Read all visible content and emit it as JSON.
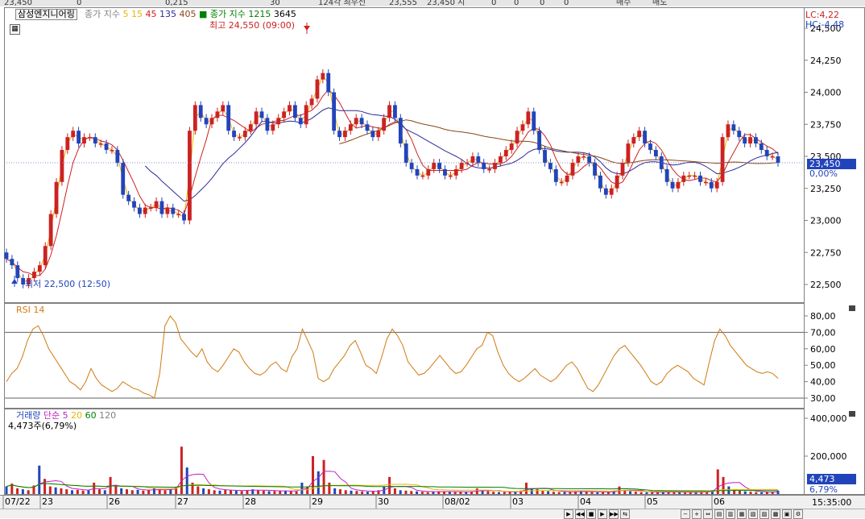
{
  "top_bar": {
    "values": [
      "23,450",
      "0",
      "0,215",
      "30",
      "124각 최우선",
      "23,555",
      "23,450 시",
      "0",
      "0",
      "0",
      "0",
      "매수",
      "매도"
    ]
  },
  "symbol": "삼성엔지니어링",
  "legend": {
    "price_ma_label": "종가 지수",
    "price_ma": [
      {
        "period": "5",
        "color": "#e6b800"
      },
      {
        "period": "15",
        "color": "#e6b800"
      },
      {
        "period": "45",
        "color": "#cc2222"
      },
      {
        "period": "135",
        "color": "#2b2b9c"
      },
      {
        "period": "405",
        "color": "#8b4513"
      }
    ],
    "extra_label": "종가 지수",
    "extra": [
      {
        "period": "1215",
        "color": "#008000"
      },
      {
        "period": "3645",
        "color": "#000000"
      }
    ]
  },
  "annotations": {
    "high": "최고 24,550 (09:00)",
    "low": "최저 22,500 (12:50)",
    "lc": "LC:4,22",
    "hc": "HC:-4,48",
    "current_price": "23,450",
    "change_pct": "0,00%",
    "volume_now": "4,473주(6,79%)",
    "volume_box": "4,473",
    "volume_pct": "6,79%",
    "time": "15:35:00"
  },
  "rsi_title": "RSI 14",
  "volume_title": "거래량",
  "volume_ma": [
    {
      "label": "단순 5",
      "color": "#c020c0"
    },
    {
      "label": "20",
      "color": "#e6b800"
    },
    {
      "label": "60",
      "color": "#008000"
    },
    {
      "label": "120",
      "color": "#808080"
    }
  ],
  "colors": {
    "up": "#cc2222",
    "down": "#2244bb",
    "rsi": "#d07a10",
    "axis": "#606060"
  },
  "chart_data": [
    {
      "type": "candlestick",
      "title": "삼성엔지니어링",
      "ylim": [
        22450,
        24550
      ],
      "yticks": [
        "22,500",
        "22,750",
        "23,000",
        "23,250",
        "23,500",
        "23,750",
        "24,000",
        "24,250",
        "24,500"
      ],
      "ytick_values": [
        22500,
        22750,
        23000,
        23250,
        23500,
        23750,
        24000,
        24250,
        24500
      ],
      "x_tick_labels": [
        "07/22",
        "23",
        "26",
        "27",
        "28",
        "29",
        "30",
        "08/02",
        "03",
        "04",
        "05",
        "06"
      ],
      "close_path": [
        22700,
        22650,
        22550,
        22500,
        22550,
        22600,
        22650,
        22800,
        23050,
        23300,
        23550,
        23650,
        23700,
        23600,
        23650,
        23650,
        23600,
        23600,
        23550,
        23550,
        23450,
        23200,
        23150,
        23100,
        23050,
        23100,
        23100,
        23150,
        23050,
        23100,
        23050,
        23050,
        23000,
        23700,
        23900,
        23800,
        23750,
        23800,
        23850,
        23900,
        23700,
        23650,
        23650,
        23700,
        23750,
        23850,
        23800,
        23700,
        23750,
        23800,
        23850,
        23900,
        23800,
        23750,
        23900,
        23950,
        24100,
        24150,
        24000,
        23700,
        23650,
        23700,
        23750,
        23800,
        23750,
        23700,
        23650,
        23700,
        23800,
        23900,
        23800,
        23600,
        23450,
        23400,
        23350,
        23350,
        23400,
        23450,
        23400,
        23350,
        23350,
        23400,
        23450,
        23450,
        23500,
        23450,
        23400,
        23400,
        23450,
        23500,
        23550,
        23600,
        23700,
        23750,
        23850,
        23700,
        23550,
        23450,
        23400,
        23300,
        23300,
        23350,
        23450,
        23500,
        23500,
        23450,
        23350,
        23250,
        23200,
        23250,
        23350,
        23450,
        23600,
        23650,
        23700,
        23600,
        23550,
        23500,
        23400,
        23300,
        23250,
        23300,
        23350,
        23350,
        23350,
        23300,
        23300,
        23250,
        23300,
        23650,
        23750,
        23700,
        23650,
        23600,
        23650,
        23600,
        23550,
        23500,
        23500,
        23450
      ],
      "ma_lines": [
        "5",
        "15",
        "45",
        "135",
        "405"
      ]
    },
    {
      "type": "line",
      "title": "RSI 14",
      "ylim": [
        25,
        85
      ],
      "yticks": [
        "30,00",
        "40,00",
        "50,00",
        "60,00",
        "70,00",
        "80,00"
      ],
      "ytick_values": [
        30,
        40,
        50,
        60,
        70,
        80
      ],
      "reference_lines": [
        70,
        30
      ],
      "values": [
        40,
        45,
        48,
        55,
        65,
        72,
        74,
        68,
        60,
        55,
        50,
        45,
        40,
        38,
        35,
        40,
        48,
        42,
        38,
        36,
        34,
        36,
        40,
        38,
        36,
        35,
        33,
        32,
        30,
        45,
        74,
        80,
        76,
        66,
        62,
        58,
        55,
        60,
        52,
        48,
        46,
        50,
        55,
        60,
        58,
        52,
        48,
        45,
        44,
        46,
        50,
        52,
        48,
        46,
        55,
        60,
        72,
        65,
        58,
        42,
        40,
        42,
        48,
        52,
        56,
        62,
        65,
        58,
        50,
        48,
        45,
        55,
        66,
        72,
        68,
        62,
        52,
        48,
        44,
        45,
        48,
        52,
        56,
        52,
        48,
        45,
        46,
        50,
        55,
        60,
        62,
        70,
        68,
        58,
        50,
        45,
        42,
        40,
        42,
        45,
        48,
        44,
        42,
        40,
        42,
        46,
        50,
        52,
        48,
        42,
        36,
        34,
        38,
        44,
        50,
        56,
        60,
        62,
        58,
        54,
        50,
        45,
        40,
        38,
        40,
        45,
        48,
        50,
        48,
        46,
        42,
        40,
        38,
        52,
        65,
        72,
        68,
        62,
        58,
        54,
        50,
        48,
        46,
        45,
        46,
        45,
        42
      ]
    },
    {
      "type": "bar",
      "title": "거래량",
      "ylim": [
        0,
        420000
      ],
      "yticks": [
        "200,000",
        "400,000"
      ],
      "ytick_values": [
        200000,
        400000
      ],
      "values": [
        40000,
        55000,
        30000,
        25000,
        20000,
        45000,
        150000,
        80000,
        40000,
        35000,
        30000,
        25000,
        20000,
        22000,
        18000,
        20000,
        60000,
        25000,
        20000,
        90000,
        40000,
        30000,
        25000,
        20000,
        22000,
        18000,
        20000,
        30000,
        25000,
        20000,
        25000,
        35000,
        250000,
        140000,
        60000,
        40000,
        30000,
        25000,
        20000,
        18000,
        22000,
        20000,
        18000,
        16000,
        20000,
        25000,
        20000,
        18000,
        15000,
        16000,
        15000,
        18000,
        16000,
        14000,
        60000,
        40000,
        200000,
        120000,
        180000,
        60000,
        30000,
        25000,
        20000,
        18000,
        16000,
        14000,
        12000,
        15000,
        20000,
        40000,
        90000,
        30000,
        20000,
        18000,
        16000,
        14000,
        12000,
        10000,
        12000,
        14000,
        15000,
        12000,
        10000,
        11000,
        12000,
        14000,
        30000,
        20000,
        15000,
        12000,
        10000,
        11000,
        12000,
        14000,
        18000,
        60000,
        30000,
        25000,
        18000,
        15000,
        12000,
        10000,
        11000,
        12000,
        14000,
        16000,
        12000,
        10000,
        9000,
        10000,
        12000,
        15000,
        40000,
        20000,
        15000,
        12000,
        10000,
        9000,
        10000,
        11000,
        12000,
        12000,
        10000,
        9000,
        8000,
        10000,
        12000,
        11000,
        10000,
        20000,
        130000,
        90000,
        40000,
        25000,
        18000,
        14000,
        12000,
        10000,
        9000,
        11000,
        12000,
        18000
      ],
      "current": 4473
    }
  ]
}
